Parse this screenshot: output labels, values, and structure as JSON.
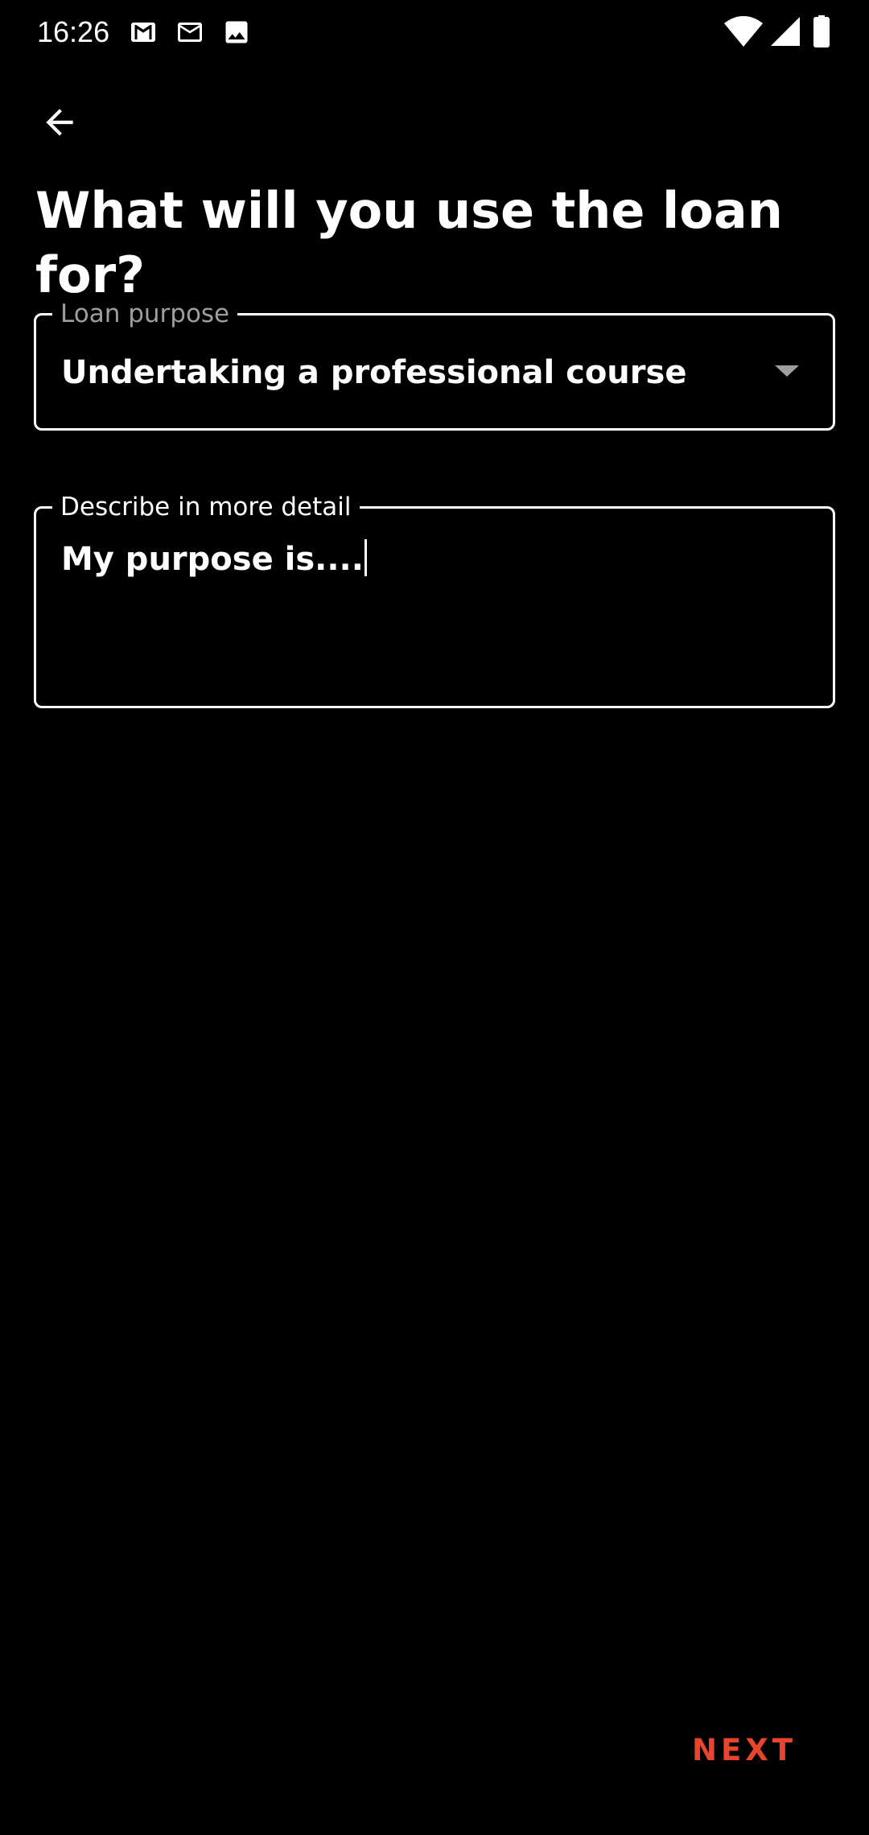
{
  "status_bar": {
    "time": "16:26",
    "notification_icons": [
      "gmail-icon",
      "mail-icon",
      "image-icon"
    ],
    "system_icons": [
      "wifi-icon",
      "signal-icon",
      "battery-icon"
    ]
  },
  "header": {
    "back_icon": "arrow-left-icon",
    "title": "What will you use the loan for?"
  },
  "form": {
    "loan_purpose": {
      "label": "Loan purpose",
      "value": "Undertaking a professional course",
      "icon": "dropdown-arrow-icon"
    },
    "detail": {
      "label": "Describe in more detail",
      "value": "My purpose is...."
    }
  },
  "footer": {
    "next_label": "NEXT"
  },
  "colors": {
    "background": "#000000",
    "text": "#ffffff",
    "muted": "#9e9e9e",
    "accent": "#e8452c"
  }
}
